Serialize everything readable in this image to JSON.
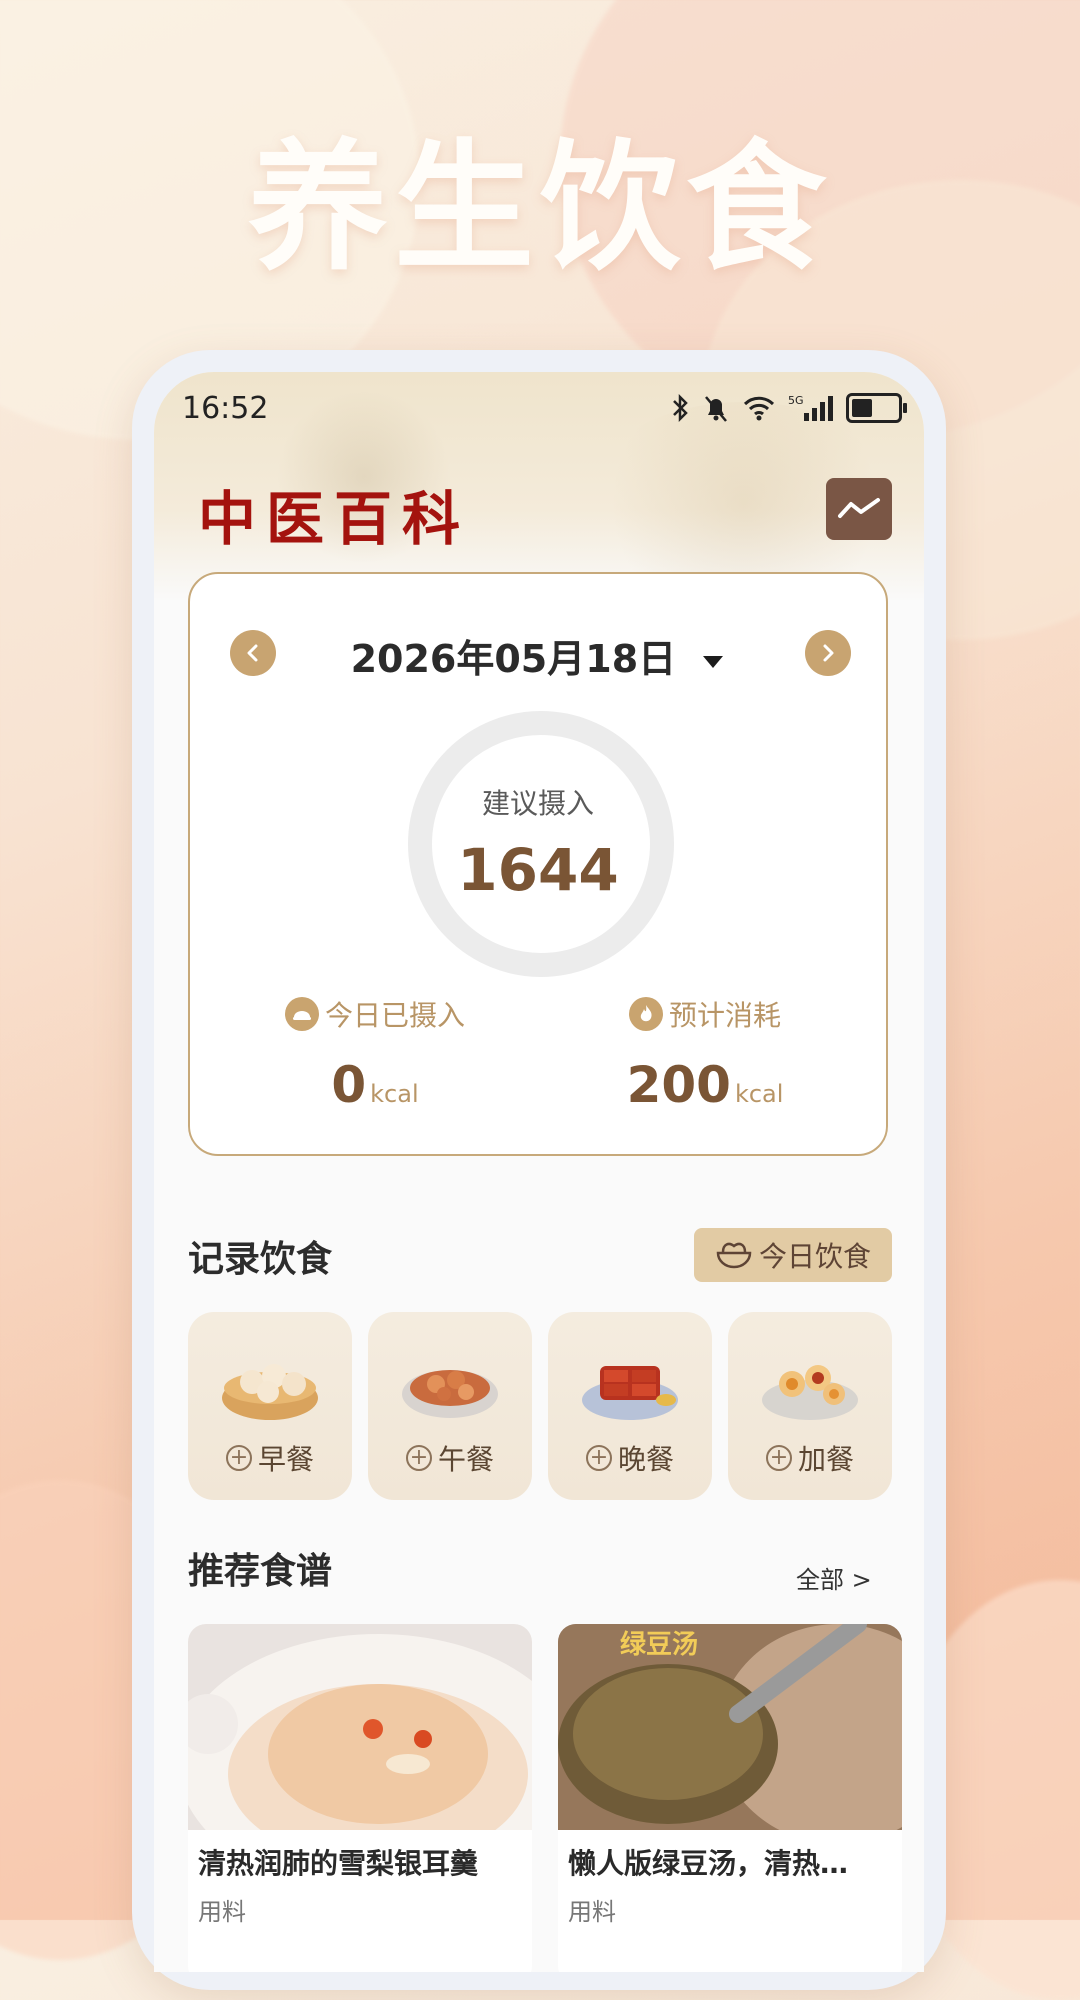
{
  "promo": {
    "title": "养生饮食"
  },
  "status": {
    "time": "16:52"
  },
  "app": {
    "title": "中医百科"
  },
  "icons": {
    "trend": "trend-chart-icon",
    "prev": "chevron-left-icon",
    "next": "chevron-right-icon",
    "caret": "caret-down-icon",
    "intake": "food-icon",
    "burn": "flame-icon",
    "bowl": "rice-bowl-icon"
  },
  "summary": {
    "date": "2026年05月18日",
    "ring_label": "建议摄入",
    "ring_value": "1644",
    "intake_label": "今日已摄入",
    "intake_value": "0",
    "intake_unit": "kcal",
    "burn_label": "预计消耗",
    "burn_value": "200",
    "burn_unit": "kcal"
  },
  "record": {
    "title": "记录饮食",
    "today_button": "今日饮食",
    "meals": [
      {
        "label": "早餐"
      },
      {
        "label": "午餐"
      },
      {
        "label": "晚餐"
      },
      {
        "label": "加餐"
      }
    ]
  },
  "recipes": {
    "title": "推荐食谱",
    "all_link": "全部 >",
    "items": [
      {
        "name": "清热润肺的雪梨银耳羹",
        "sub": "用料"
      },
      {
        "name": "懒人版绿豆汤，清热…",
        "sub": "用料",
        "image_text": "绿豆汤"
      }
    ]
  },
  "colors": {
    "accent": "#c8a471",
    "title_red": "#a4130e",
    "value_brown": "#7a5535"
  }
}
